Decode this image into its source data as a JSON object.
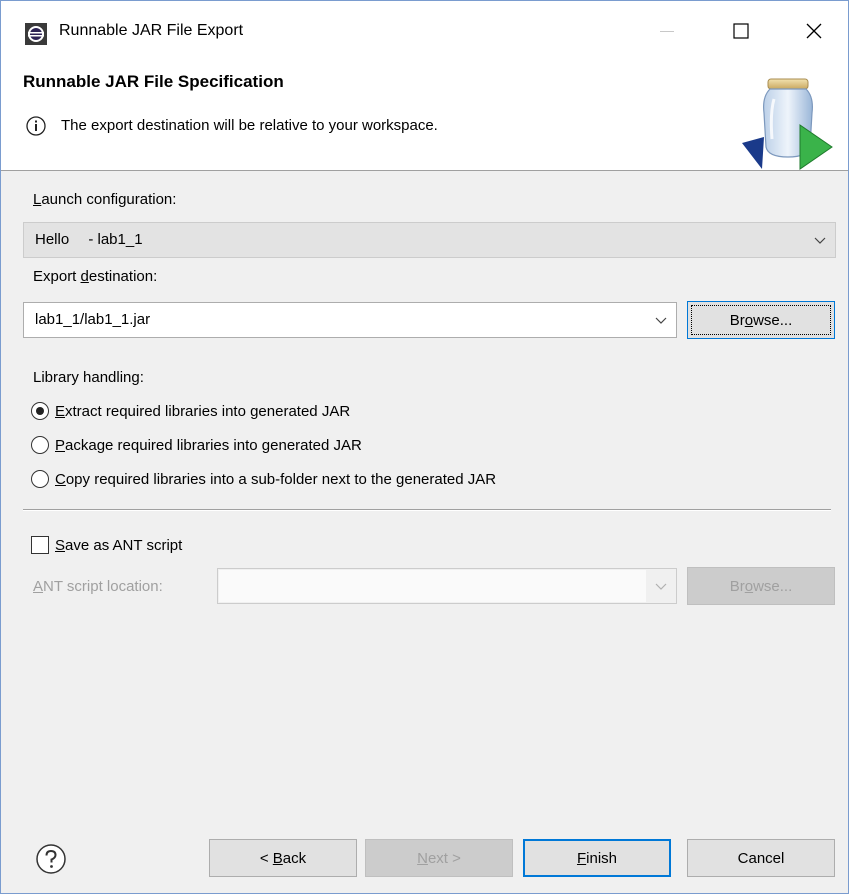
{
  "window": {
    "title": "Runnable JAR File Export",
    "controls": {
      "minimize": "minimize-icon",
      "maximize": "maximize-icon",
      "close": "close-icon"
    }
  },
  "banner": {
    "title": "Runnable JAR File Specification",
    "message": "The export destination will be relative to your workspace."
  },
  "launch": {
    "label_prefix": "",
    "label_mnemonic": "L",
    "label_rest": "aunch configuration:",
    "value": "Hello  - lab1_1"
  },
  "export": {
    "label_prefix": "Export ",
    "label_mnemonic": "d",
    "label_rest": "estination:",
    "value": "lab1_1/lab1_1.jar",
    "browse_prefix": "Br",
    "browse_mnemonic": "o",
    "browse_rest": "wse..."
  },
  "library": {
    "label": "Library handling:",
    "options": [
      {
        "mnemonic": "E",
        "rest": "xtract required libraries into generated JAR",
        "checked": true
      },
      {
        "mnemonic": "P",
        "rest": "ackage required libraries into generated JAR",
        "checked": false
      },
      {
        "mnemonic": "C",
        "rest": "opy required libraries into a sub-folder next to the generated JAR",
        "checked": false
      }
    ]
  },
  "ant": {
    "save_mnemonic": "S",
    "save_rest": "ave as ANT script",
    "save_checked": false,
    "location_mnemonic": "A",
    "location_rest": "NT script location:",
    "browse_prefix": "Br",
    "browse_mnemonic": "o",
    "browse_rest": "wse..."
  },
  "footer": {
    "help": "help-icon",
    "back_prefix": "< ",
    "back_mnemonic": "B",
    "back_rest": "ack",
    "next_mnemonic": "N",
    "next_rest": "ext >",
    "finish_mnemonic": "F",
    "finish_rest": "inish",
    "cancel": "Cancel"
  },
  "colors": {
    "accent": "#0078d7",
    "window_border": "#7a9ccf",
    "dialog_bg": "#f0f0f0",
    "disabled_text": "#a0a0a0"
  }
}
